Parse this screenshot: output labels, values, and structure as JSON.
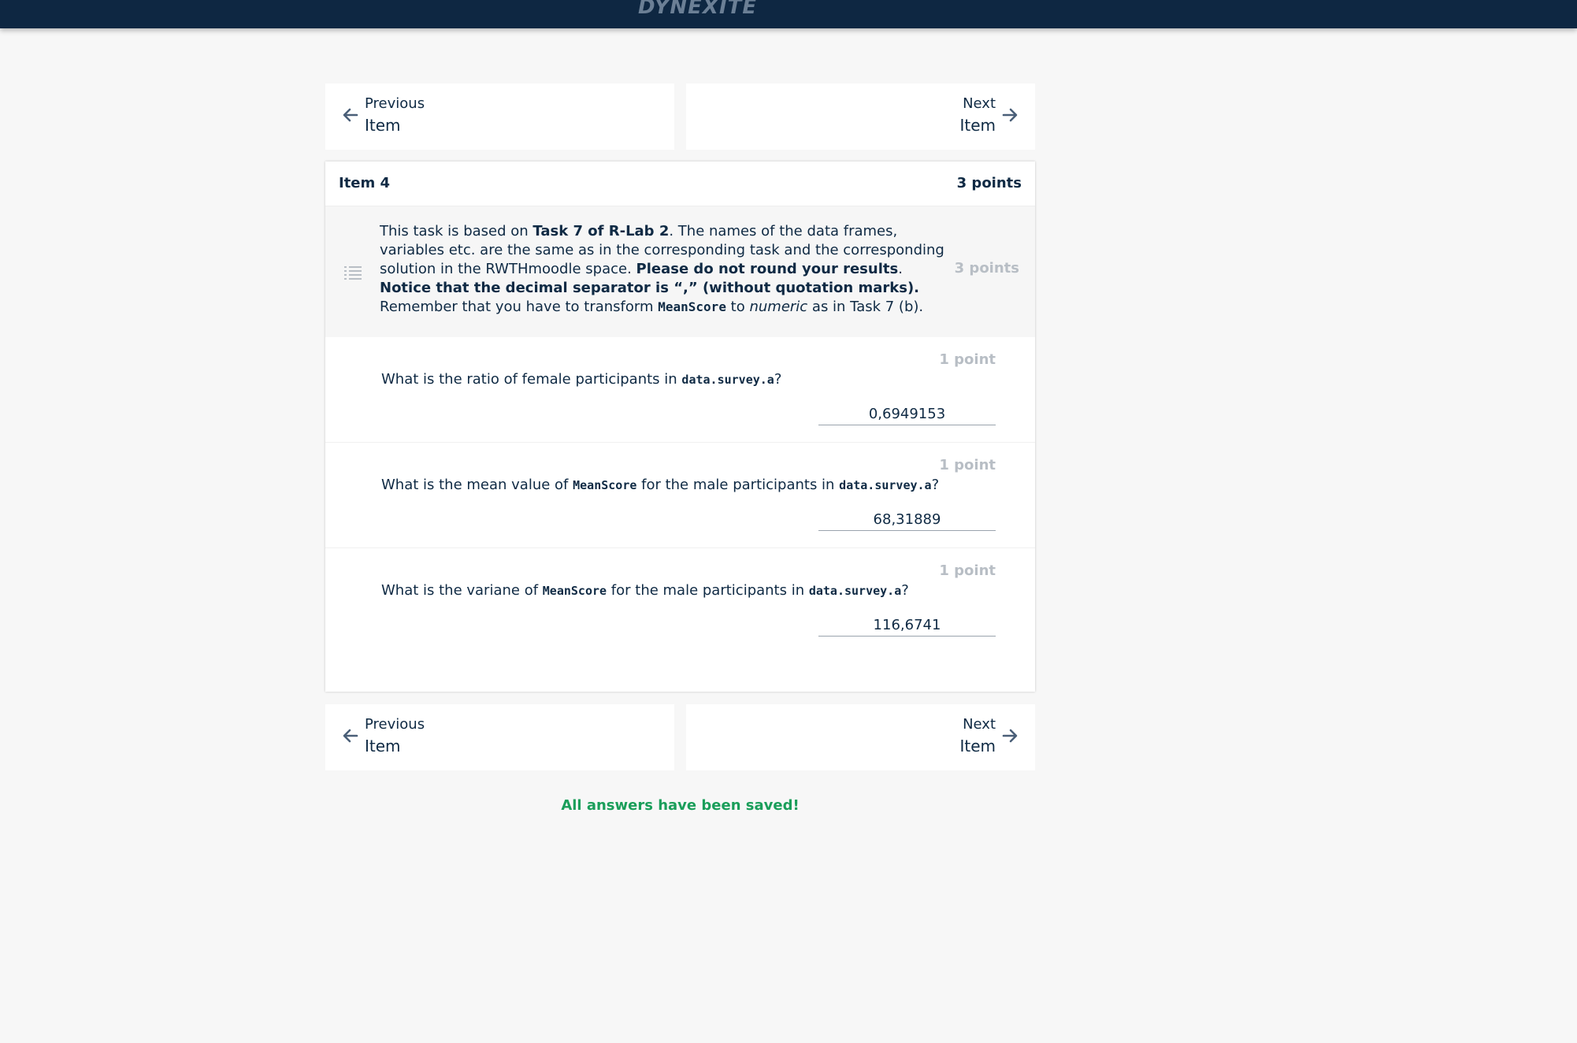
{
  "header": {
    "logo_text": "DYNEXITE"
  },
  "nav": {
    "prev_line1": "Previous",
    "prev_line2": "Item",
    "next_line1": "Next",
    "next_line2": "Item"
  },
  "item": {
    "title": "Item 4",
    "points": "3 points",
    "intro": {
      "t1": "This task is based on ",
      "b1": "Task 7 of R-Lab 2",
      "t2": ". The names of the data frames, variables etc. are the same as in the corresponding task and the corresponding solution in the RWTHmoodle space. ",
      "b2": "Please do not round your results",
      "t3": ". ",
      "b3": "Notice that the decimal separator is “,” (without quotation marks).",
      "t4": " Remember that you have to transform ",
      "c1": "MeanScore",
      "t5": " to ",
      "i1": "numeric",
      "t6": " as in Task 7 (b).",
      "points": "3 points"
    },
    "questions": [
      {
        "points": "1 point",
        "pre": "What is the ratio of female participants in ",
        "code1": "data.survey.a",
        "post": "?",
        "answer": "0,6949153"
      },
      {
        "points": "1 point",
        "pre": "What is the mean value of ",
        "code1": "MeanScore",
        "mid": " for the male participants in ",
        "code2": "data.survey.a",
        "post": "?",
        "answer": "68,31889"
      },
      {
        "points": "1 point",
        "pre": "What is the variane of ",
        "code1": "MeanScore",
        "mid": " for the male participants in ",
        "code2": "data.survey.a",
        "post": "?",
        "answer": "116,6741"
      }
    ]
  },
  "status": {
    "saved": "All answers have been saved!"
  },
  "colors": {
    "header_bg": "#0e2742",
    "text": "#0f2a44",
    "success": "#1a9e5a",
    "muted": "#b8bec5"
  }
}
